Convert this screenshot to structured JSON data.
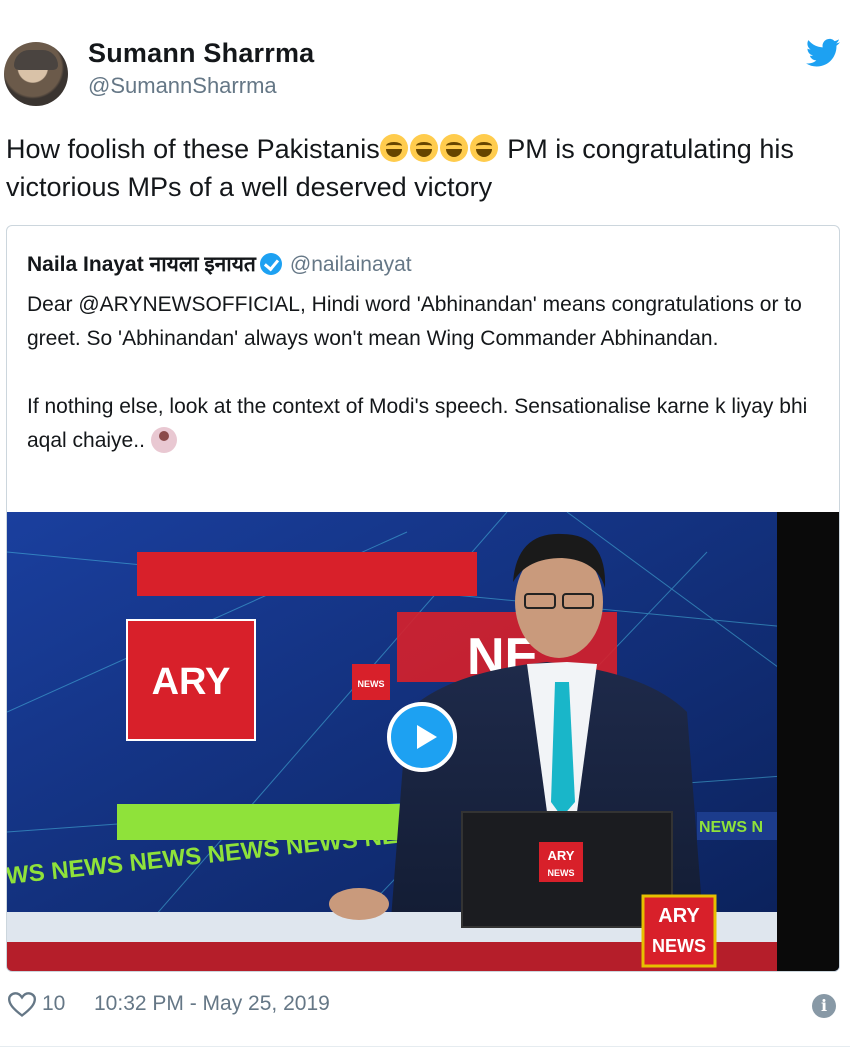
{
  "author": {
    "display_name": "Sumann Sharrma",
    "handle": "@SumannSharrma",
    "avatar_icon": "user-avatar"
  },
  "tweet": {
    "text_before_emoji": "How foolish of these Pakistanis",
    "text_after_emoji": " PM is congratulating his victorious MPs of a well deserved victory",
    "emoji_icons": [
      "laughing-emoji",
      "crying-laughing-emoji",
      "laughing-emoji",
      "crying-laughing-emoji"
    ]
  },
  "quoted_tweet": {
    "display_name": "Naila Inayat नायला इनायत",
    "handle": "@nailainayat",
    "paragraph_1": "Dear @ARYNEWSOFFICIAL, Hindi word 'Abhinandan' means congratulations or to greet. So 'Abhinandan' always won't mean Wing Commander Abhinandan.",
    "paragraph_2": "If nothing else, look at the context of Modi's speech. Sensationalise karne k liyay bhi aqal chaiye..",
    "media": {
      "screen_logo": "ARY",
      "screen_small_badge": "NEWS",
      "screen_ticker": "WS NEWS NEWS NEWS NEWS NE",
      "screen_right_text": "NE",
      "right_ticker": "NEWS N",
      "laptop_logo_top": "ARY",
      "laptop_logo_bottom": "NEWS",
      "corner_logo_top": "ARY",
      "corner_logo_bottom": "NEWS"
    }
  },
  "footer": {
    "like_count": "10",
    "timestamp": "10:32 PM - May 25, 2019",
    "info_label": "i"
  },
  "colors": {
    "twitter_blue": "#1da1f2",
    "text": "#14171a",
    "muted": "#657786",
    "border": "#ccd6dd",
    "ary_red": "#d8202a"
  }
}
